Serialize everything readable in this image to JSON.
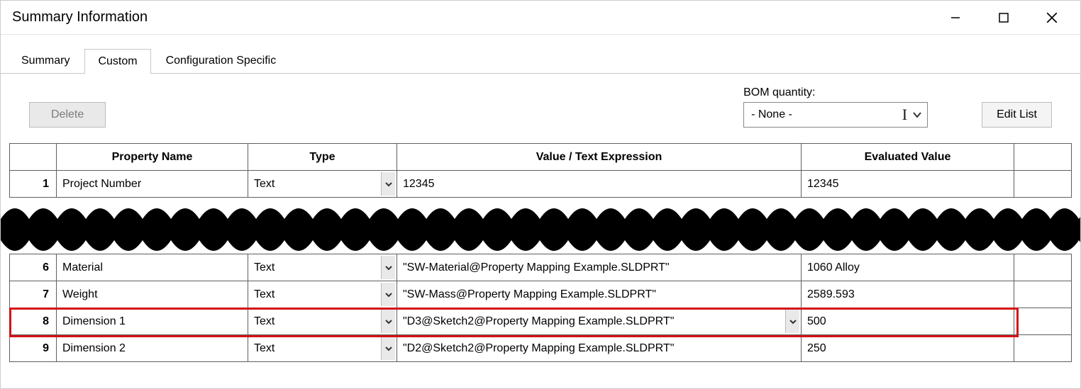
{
  "window": {
    "title": "Summary Information"
  },
  "tabs": [
    {
      "label": "Summary",
      "active": false
    },
    {
      "label": "Custom",
      "active": true
    },
    {
      "label": "Configuration Specific",
      "active": false
    }
  ],
  "toolbar": {
    "delete_label": "Delete",
    "bom_label": "BOM quantity:",
    "bom_value": "- None -",
    "edit_list_label": "Edit List"
  },
  "columns": {
    "name": "Property Name",
    "type": "Type",
    "value": "Value / Text Expression",
    "evaluated": "Evaluated Value"
  },
  "rows": [
    {
      "num": "1",
      "name": "Project Number",
      "type": "Text",
      "value": "12345",
      "evaluated": "12345",
      "dd_value": false,
      "cropped": true
    },
    {
      "num": "6",
      "name": "Material",
      "type": "Text",
      "value": "\"SW-Material@Property Mapping Example.SLDPRT\"",
      "evaluated": "1060 Alloy",
      "dd_value": false,
      "cropped": true
    },
    {
      "num": "7",
      "name": "Weight",
      "type": "Text",
      "value": "\"SW-Mass@Property Mapping Example.SLDPRT\"",
      "evaluated": "2589.593",
      "dd_value": false
    },
    {
      "num": "8",
      "name": "Dimension 1",
      "type": "Text",
      "value": "\"D3@Sketch2@Property Mapping Example.SLDPRT\"",
      "evaluated": "500",
      "dd_value": true,
      "highlight": true
    },
    {
      "num": "9",
      "name": "Dimension 2",
      "type": "Text",
      "value": "\"D2@Sketch2@Property Mapping Example.SLDPRT\"",
      "evaluated": "250",
      "dd_value": false
    }
  ]
}
